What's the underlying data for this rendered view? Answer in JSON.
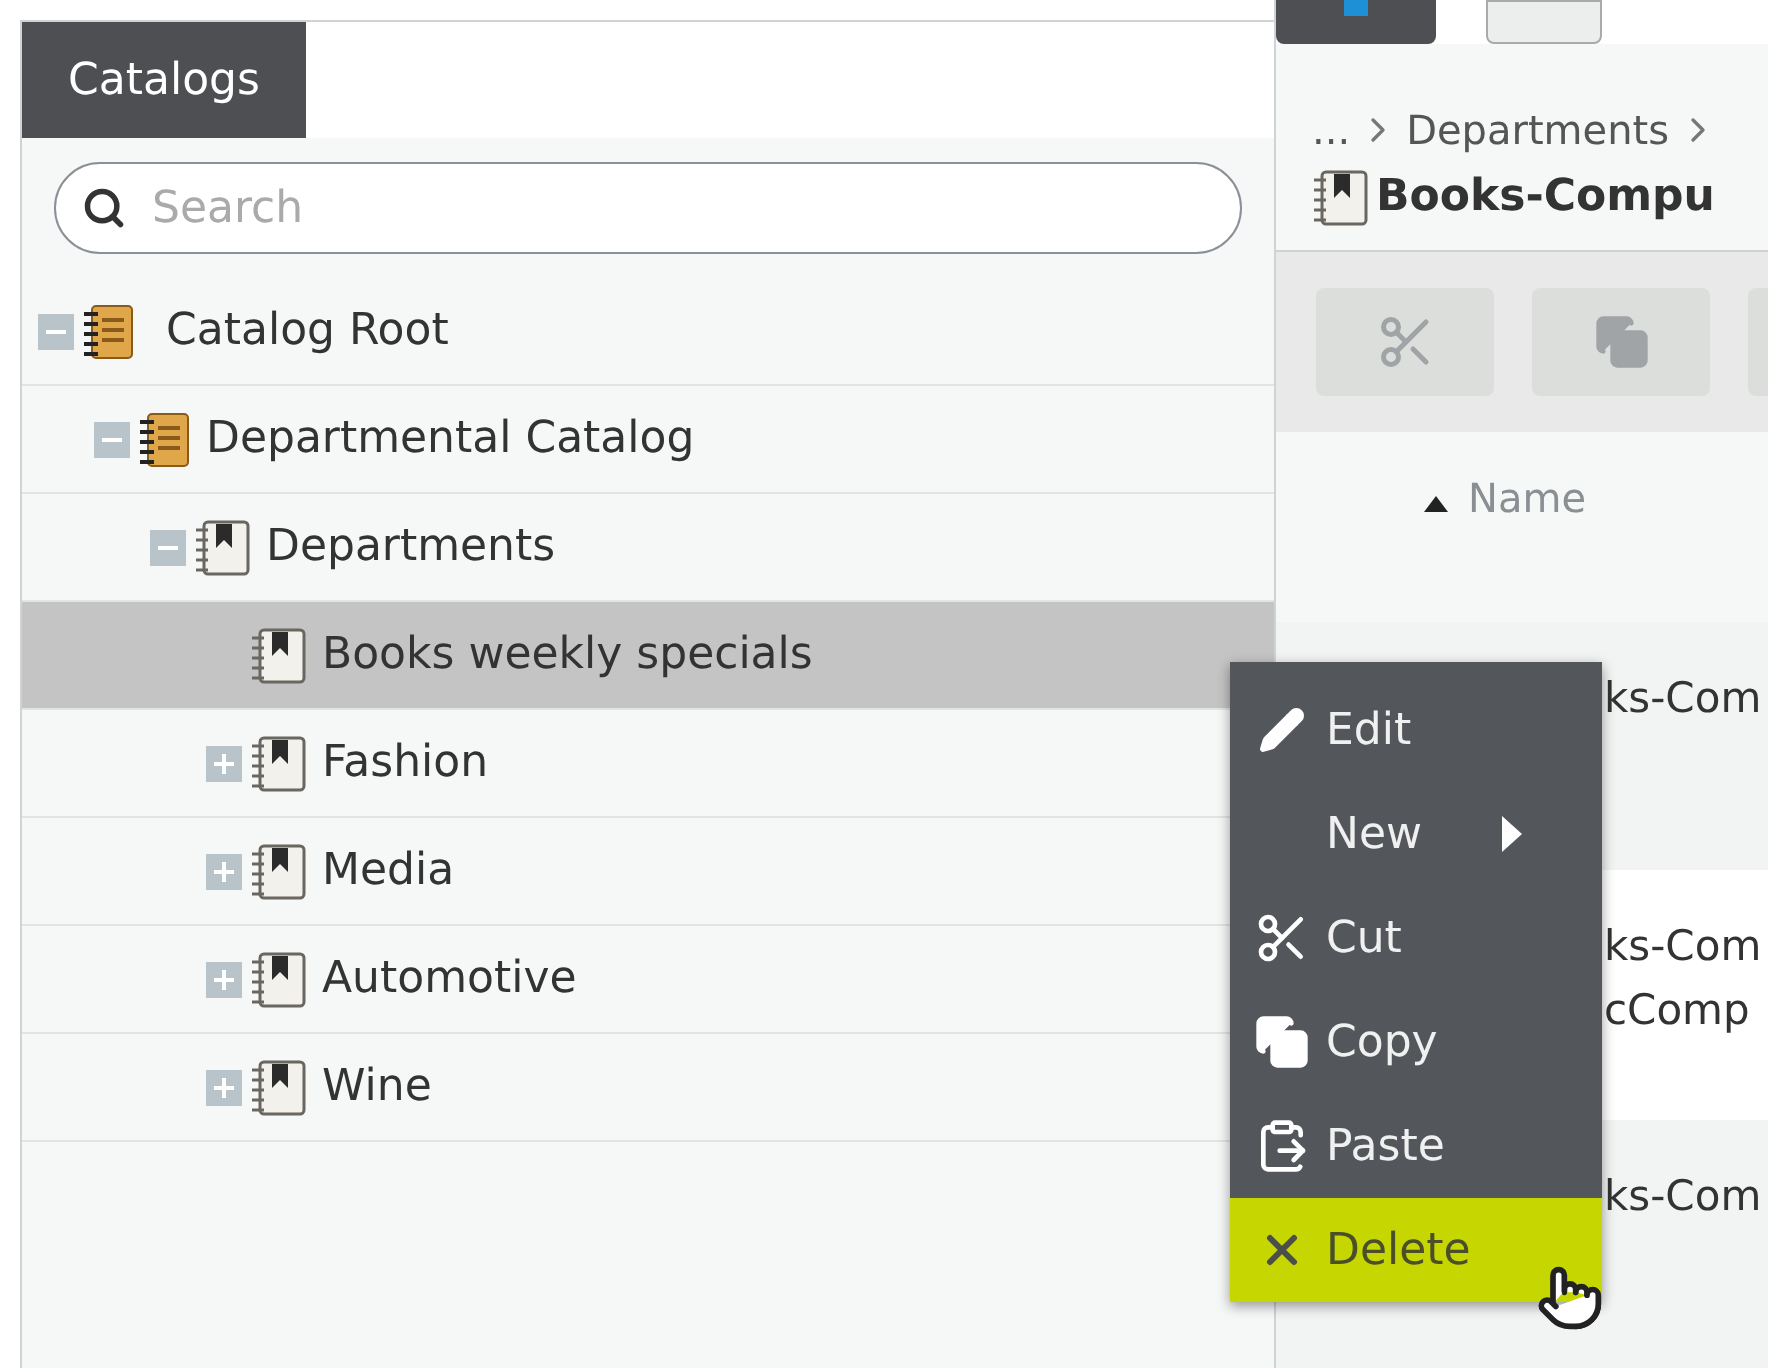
{
  "sidebar": {
    "tab": "Catalogs",
    "search": {
      "placeholder": "Search"
    },
    "tree": [
      {
        "label": "Catalog Root",
        "kind": "catalog",
        "expanded": true,
        "selected": false,
        "children": [
          {
            "label": "Departmental Catalog",
            "kind": "catalog",
            "expanded": true,
            "selected": false,
            "children": [
              {
                "label": "Departments",
                "kind": "category",
                "expanded": true,
                "selected": false,
                "children": [
                  {
                    "label": "Books weekly specials",
                    "kind": "category",
                    "selected": true
                  },
                  {
                    "label": "Fashion",
                    "kind": "category",
                    "expanded": false,
                    "selected": false
                  },
                  {
                    "label": "Media",
                    "kind": "category",
                    "expanded": false,
                    "selected": false
                  },
                  {
                    "label": "Automotive",
                    "kind": "category",
                    "expanded": false,
                    "selected": false
                  },
                  {
                    "label": "Wine",
                    "kind": "category",
                    "expanded": false,
                    "selected": false
                  }
                ]
              }
            ]
          }
        ]
      }
    ]
  },
  "content": {
    "breadcrumb": [
      "...",
      "Departments"
    ],
    "title": "Books-Compu",
    "table": {
      "columns": [
        {
          "label": "Name",
          "sorted": true
        }
      ],
      "rows": [
        {
          "lines": [
            "ks-Com"
          ]
        },
        {
          "lines": [
            "ks-Com",
            "cComp"
          ]
        },
        {
          "lines": [
            "ks-Com"
          ]
        }
      ]
    }
  },
  "context_menu": {
    "items": [
      {
        "label": "Edit",
        "submenu": false,
        "selected": false
      },
      {
        "label": "New",
        "submenu": true,
        "selected": false
      },
      {
        "label": "Cut",
        "submenu": false,
        "selected": false
      },
      {
        "label": "Copy",
        "submenu": false,
        "selected": false
      },
      {
        "label": "Paste",
        "submenu": false,
        "selected": false
      },
      {
        "label": "Delete",
        "submenu": false,
        "selected": true
      }
    ]
  }
}
